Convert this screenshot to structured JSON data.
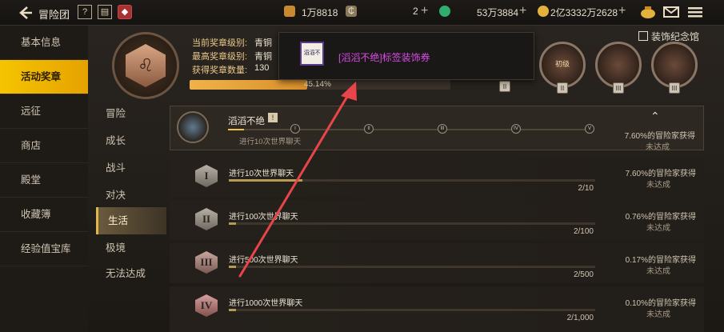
{
  "topbar": {
    "title": "冒险团",
    "help_icon": "?",
    "res1_value": "1万8818",
    "res2_value": "2",
    "res3_value": "53万3884",
    "res4_value": "2亿3332万2628"
  },
  "leftnav": {
    "items": [
      {
        "label": "基本信息"
      },
      {
        "label": "活动奖章"
      },
      {
        "label": "远征"
      },
      {
        "label": "商店"
      },
      {
        "label": "殿堂"
      },
      {
        "label": "收藏簿"
      },
      {
        "label": "经验值宝库"
      }
    ]
  },
  "subnav": {
    "items": [
      {
        "label": "冒险"
      },
      {
        "label": "成长"
      },
      {
        "label": "战斗"
      },
      {
        "label": "对决"
      },
      {
        "label": "生活"
      },
      {
        "label": "极境"
      },
      {
        "label": "无法达成"
      }
    ]
  },
  "summary": {
    "current_label": "当前奖章级别:",
    "current_value": "青铜",
    "highest_label": "最高奖章级别:",
    "highest_value": "青铜",
    "count_label": "获得奖章数量:",
    "count_value": "130",
    "progress_text": "45.14%",
    "progress": 0.4514
  },
  "deco_link": "装饰纪念馆",
  "medals": [
    {
      "label": "初级"
    },
    {
      "label": ""
    },
    {
      "label": ""
    }
  ],
  "tooltip": {
    "icon_text": "滔滔不绝",
    "text": "[滔滔不绝]标签装饰券"
  },
  "card": {
    "title": "滔滔不绝",
    "sub": "进行10次世界聊天",
    "rate": "7.60%的冒险家获得",
    "status": "未达成",
    "stages": [
      "I",
      "II",
      "III",
      "IV",
      "V"
    ]
  },
  "rows": [
    {
      "numeral": "I",
      "title": "进行10次世界聊天",
      "count": "2/10",
      "progress": 0.2,
      "rate": "7.60%的冒险家获得",
      "status": "未达成"
    },
    {
      "numeral": "II",
      "title": "进行100次世界聊天",
      "count": "2/100",
      "progress": 0.02,
      "rate": "0.76%的冒险家获得",
      "status": "未达成"
    },
    {
      "numeral": "III",
      "title": "进行500次世界聊天",
      "count": "2/500",
      "progress": 0.004,
      "rate": "0.17%的冒险家获得",
      "status": "未达成"
    },
    {
      "numeral": "IV",
      "title": "进行1000次世界聊天",
      "count": "2/1,000",
      "progress": 0.002,
      "rate": "0.10%的冒险家获得",
      "status": "未达成"
    }
  ],
  "colors": {
    "accent": "#f5c400",
    "tooltip_text": "#d84be6",
    "arrow": "#e8454a"
  }
}
